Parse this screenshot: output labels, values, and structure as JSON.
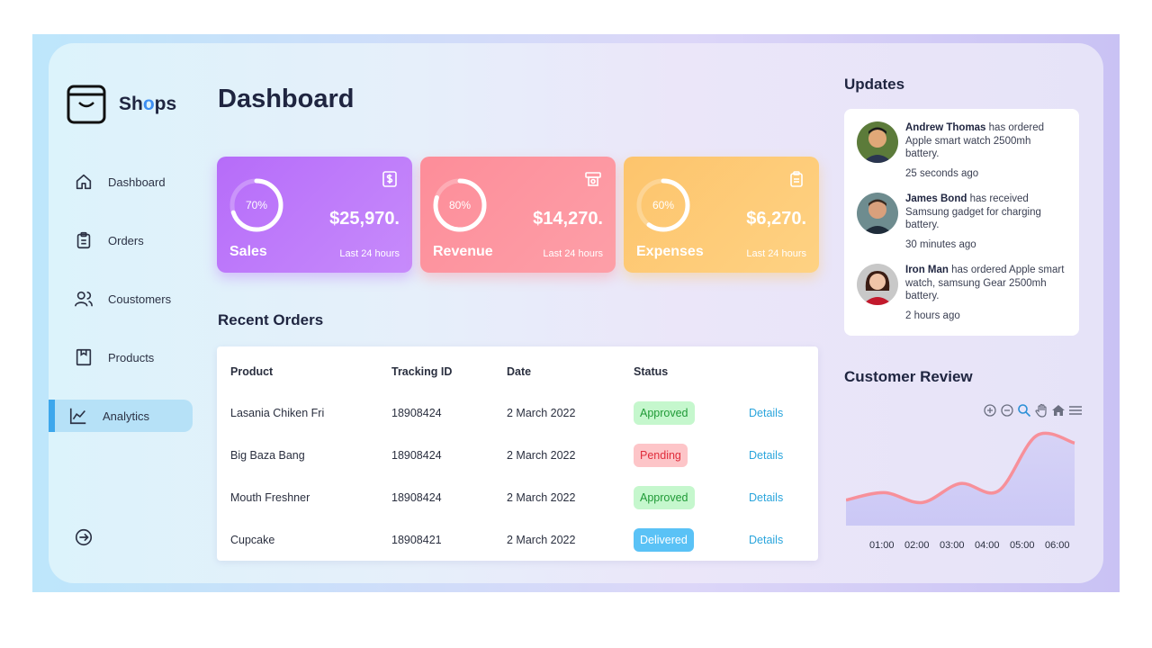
{
  "brand": {
    "name_pre": "Sh",
    "name_o": "o",
    "name_post": "ps"
  },
  "nav": {
    "dashboard": "Dashboard",
    "orders": "Orders",
    "customers": "Coustomers",
    "products": "Products",
    "analytics": "Analytics"
  },
  "page_title": "Dashboard",
  "stats": [
    {
      "name": "Sales",
      "value": "$25,970.",
      "percent": "70%",
      "fill": 0.7,
      "sub": "Last 24 hours",
      "icon": "dollar-icon"
    },
    {
      "name": "Revenue",
      "value": "$14,270.",
      "percent": "80%",
      "fill": 0.8,
      "sub": "Last 24 hours",
      "icon": "atm-icon"
    },
    {
      "name": "Expenses",
      "value": "$6,270.",
      "percent": "60%",
      "fill": 0.6,
      "sub": "Last 24 hours",
      "icon": "clipboard-icon"
    }
  ],
  "recent_orders": {
    "title": "Recent Orders",
    "headers": [
      "Product",
      "Tracking ID",
      "Date",
      "Status"
    ],
    "rows": [
      {
        "product": "Lasania Chiken Fri",
        "tracking": "18908424",
        "date": "2 March 2022",
        "status": "Approved",
        "action": "Details"
      },
      {
        "product": "Big Baza Bang",
        "tracking": "18908424",
        "date": "2 March 2022",
        "status": "Pending",
        "action": "Details"
      },
      {
        "product": "Mouth Freshner",
        "tracking": "18908424",
        "date": "2 March 2022",
        "status": "Approved",
        "action": "Details"
      },
      {
        "product": "Cupcake",
        "tracking": "18908421",
        "date": "2 March 2022",
        "status": "Delivered",
        "action": "Details"
      }
    ]
  },
  "updates": {
    "title": "Updates",
    "items": [
      {
        "name": "Andrew Thomas",
        "text": " has ordered Apple smart watch 2500mh battery.",
        "time": "25 seconds ago"
      },
      {
        "name": "James Bond",
        "text": " has received Samsung gadget for charging battery.",
        "time": "30 minutes ago"
      },
      {
        "name": "Iron Man",
        "text": " has ordered Apple smart watch, samsung Gear 2500mh battery.",
        "time": "2 hours ago"
      }
    ]
  },
  "customer_review": {
    "title": "Customer Review",
    "toolbar_icons": [
      "zoom-in-icon",
      "zoom-out-icon",
      "magnifier-icon",
      "pan-hand-icon",
      "home-icon",
      "menu-icon"
    ]
  },
  "chart_data": {
    "type": "area",
    "x": [
      "01:00",
      "02:00",
      "03:00",
      "04:00",
      "05:00",
      "06:00"
    ],
    "series": [
      {
        "values": [
          31,
          40,
          28,
          51,
          42,
          109,
          100
        ]
      }
    ],
    "colors": {
      "line": "#f7909a",
      "fill": "#c9c6f5"
    }
  }
}
